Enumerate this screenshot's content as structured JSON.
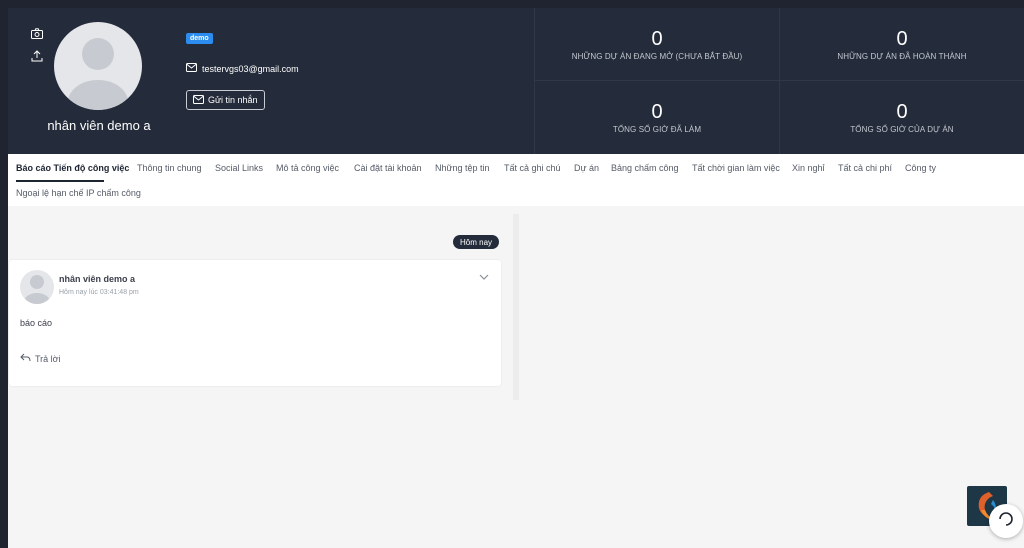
{
  "profile": {
    "name": "nhân viên demo a",
    "badge": "demo",
    "email": "testervgs03@gmail.com",
    "send_message_label": "Gửi tin nhắn"
  },
  "stats": [
    {
      "value": "0",
      "label": "NHỮNG DỰ ÁN ĐANG MỞ (CHƯA BẮT ĐẦU)"
    },
    {
      "value": "0",
      "label": "NHỮNG DỰ ÁN ĐÃ HOÀN THÀNH"
    },
    {
      "value": "0",
      "label": "TỔNG SỐ GIỜ ĐÃ LÀM"
    },
    {
      "value": "0",
      "label": "TỔNG SỐ GIỜ CỦA DỰ ÁN"
    }
  ],
  "tabs": [
    {
      "label": "Báo cáo Tiến độ công việc",
      "active": true
    },
    {
      "label": "Thông tin chung"
    },
    {
      "label": "Social Links"
    },
    {
      "label": "Mô tả công việc"
    },
    {
      "label": "Cài đặt tài khoản"
    },
    {
      "label": "Những tệp tin"
    },
    {
      "label": "Tất cả ghi chú"
    },
    {
      "label": "Dự án"
    },
    {
      "label": "Bảng chấm công"
    },
    {
      "label": "Tất chời gian làm việc"
    },
    {
      "label": "Xin nghỉ"
    },
    {
      "label": "Tất cả chi phí"
    },
    {
      "label": "Công ty"
    },
    {
      "label": "Ngoại lệ hạn chế IP chấm công"
    }
  ],
  "timeline": {
    "today_label": "Hôm nay"
  },
  "post": {
    "author": "nhân viên demo a",
    "time": "Hôm nay lúc 03:41:48 pm",
    "body": "báo cáo",
    "reply_label": "Trả lời"
  },
  "colors": {
    "header_bg": "#242b3a",
    "badge_bg": "#2d8cf0",
    "page_bg": "#f5f5f5"
  }
}
